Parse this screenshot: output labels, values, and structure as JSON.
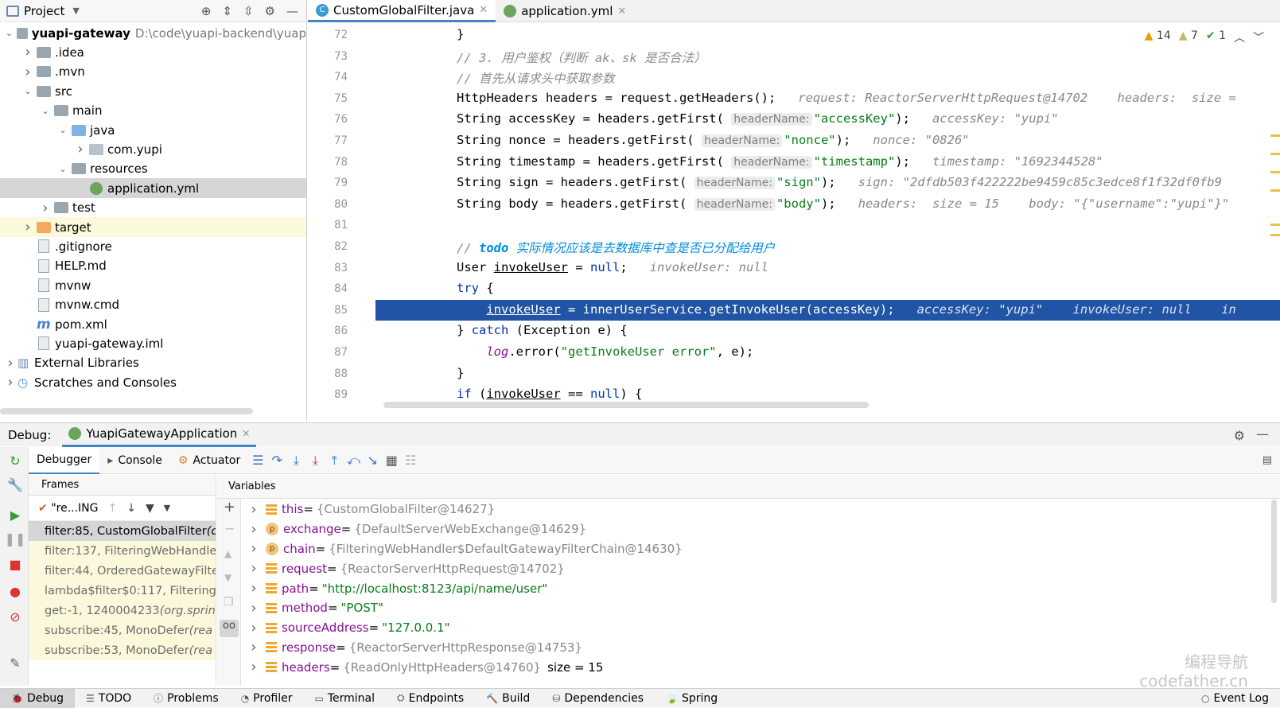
{
  "project": {
    "title": "Project",
    "tree": [
      {
        "label": "yuapi-gateway",
        "extra": "D:\\code\\yuapi-backend\\yuap",
        "indent": 0,
        "arrow": "down",
        "icon": "module-folder"
      },
      {
        "label": ".idea",
        "indent": 1,
        "arrow": "right",
        "icon": "folder"
      },
      {
        "label": ".mvn",
        "indent": 1,
        "arrow": "right",
        "icon": "folder"
      },
      {
        "label": "src",
        "indent": 1,
        "arrow": "down",
        "icon": "folder"
      },
      {
        "label": "main",
        "indent": 2,
        "arrow": "down",
        "icon": "folder"
      },
      {
        "label": "java",
        "indent": 3,
        "arrow": "down",
        "icon": "source-folder"
      },
      {
        "label": "com.yupi",
        "indent": 4,
        "arrow": "right",
        "icon": "package"
      },
      {
        "label": "resources",
        "indent": 3,
        "arrow": "down",
        "icon": "resources-folder"
      },
      {
        "label": "application.yml",
        "indent": 4,
        "arrow": "",
        "icon": "yml"
      },
      {
        "label": "test",
        "indent": 2,
        "arrow": "right",
        "icon": "folder"
      },
      {
        "label": "target",
        "indent": 1,
        "arrow": "right",
        "icon": "excluded-folder"
      },
      {
        "label": ".gitignore",
        "indent": 1,
        "arrow": "",
        "icon": "file"
      },
      {
        "label": "HELP.md",
        "indent": 1,
        "arrow": "",
        "icon": "markdown"
      },
      {
        "label": "mvnw",
        "indent": 1,
        "arrow": "",
        "icon": "file"
      },
      {
        "label": "mvnw.cmd",
        "indent": 1,
        "arrow": "",
        "icon": "file"
      },
      {
        "label": "pom.xml",
        "indent": 1,
        "arrow": "",
        "icon": "maven"
      },
      {
        "label": "yuapi-gateway.iml",
        "indent": 1,
        "arrow": "",
        "icon": "file"
      },
      {
        "label": "External Libraries",
        "indent": 0,
        "arrow": "right",
        "icon": "libraries"
      },
      {
        "label": "Scratches and Consoles",
        "indent": 0,
        "arrow": "right",
        "icon": "scratches"
      }
    ]
  },
  "editor_tabs": [
    {
      "label": "CustomGlobalFilter.java",
      "active": true
    },
    {
      "label": "application.yml",
      "active": false
    }
  ],
  "inspections": {
    "warnings": "14",
    "weak_warnings": "7",
    "ok": "1"
  },
  "code_lines": [
    {
      "num": "72",
      "html": "}"
    },
    {
      "num": "73",
      "html": "<span class='cm'>// 3. 用户鉴权（判断 ak、sk 是否合法）</span>"
    },
    {
      "num": "74",
      "html": "<span class='cm'>// 首先从请求头中获取参数</span>"
    },
    {
      "num": "75",
      "html": "HttpHeaders headers = request.getHeaders();   <span class='hint'>request: ReactorServerHttpRequest@14702    headers:  size = </span>"
    },
    {
      "num": "76",
      "html": "String accessKey = headers.getFirst( <span class='inlay'>headerName:</span><span class='str'>\"accessKey\"</span>);   <span class='hint'>accessKey: \"yupi\"</span>"
    },
    {
      "num": "77",
      "html": "String nonce = headers.getFirst( <span class='inlay'>headerName:</span><span class='str'>\"nonce\"</span>);   <span class='hint'>nonce: \"0826\"</span>"
    },
    {
      "num": "78",
      "html": "String timestamp = headers.getFirst( <span class='inlay'>headerName:</span><span class='str'>\"timestamp\"</span>);   <span class='hint'>timestamp: \"1692344528\"</span>"
    },
    {
      "num": "79",
      "html": "String sign = headers.getFirst( <span class='inlay'>headerName:</span><span class='str'>\"sign\"</span>);   <span class='hint'>sign: \"2dfdb503f422222be9459c85c3edce8f1f32df0fb9</span>"
    },
    {
      "num": "80",
      "html": "String body = headers.getFirst( <span class='inlay'>headerName:</span><span class='str'>\"body\"</span>);   <span class='hint'>headers:  size = 15    body: \"{\"username\":\"yupi\"}\"</span>"
    },
    {
      "num": "81",
      "html": ""
    },
    {
      "num": "82",
      "html": "<span class='cm'>// </span><span class='todo'><b>todo</b> 实际情况应该是去数据库中查是否已分配给用户</span>"
    },
    {
      "num": "83",
      "html": "User <u>invokeUser</u> = <span class='kw'>null</span>;   <span class='hint'>invokeUser: null</span>"
    },
    {
      "num": "84",
      "html": "<span class='kw'>try</span> {"
    },
    {
      "num": "85",
      "html": "    <u>invokeUser</u> = innerUserService.getInvokeUser(accessKey);   <span class='hint'>accessKey: \"yupi\"    invokeUser: null    in</span>",
      "exec": true
    },
    {
      "num": "86",
      "html": "} <span class='kw'>catch</span> (Exception e) {"
    },
    {
      "num": "87",
      "html": "    <span style='color:#871094;font-style:italic'>log</span>.error(<span class='str'>\"getInvokeUser error\"</span>, e);"
    },
    {
      "num": "88",
      "html": "}"
    },
    {
      "num": "89",
      "html": "<span class='kw'>if</span> (<u>invokeUser</u> == <span class='kw'>null</span>) {"
    }
  ],
  "debug": {
    "label": "Debug:",
    "config": "YuapiGatewayApplication",
    "tabs": [
      "Debugger",
      "Console",
      "Actuator"
    ],
    "frames_title": "Frames",
    "thread": "\"re...ING",
    "frames": [
      {
        "text": "filter:85, CustomGlobalFilter",
        "italic": " (c",
        "current": true
      },
      {
        "text": "filter:137, FilteringWebHandle",
        "italic": ""
      },
      {
        "text": "filter:44, OrderedGatewayFilte",
        "italic": ""
      },
      {
        "text": "lambda$filter$0:117, Filtering",
        "italic": ""
      },
      {
        "text": "get:-1, 1240004233 ",
        "italic": "(org.sprin"
      },
      {
        "text": "subscribe:45, MonoDefer ",
        "italic": "(rea"
      },
      {
        "text": "subscribe:53, MonoDefer ",
        "italic": "(rea"
      }
    ],
    "variables_title": "Variables",
    "variables": [
      {
        "icon": "field",
        "name": "this",
        "value": "{CustomGlobalFilter@14627}",
        "kind": "obj"
      },
      {
        "icon": "param",
        "name": "exchange",
        "value": "{DefaultServerWebExchange@14629}",
        "kind": "obj"
      },
      {
        "icon": "param",
        "name": "chain",
        "value": "{FilteringWebHandler$DefaultGatewayFilterChain@14630}",
        "kind": "obj"
      },
      {
        "icon": "field",
        "name": "request",
        "value": "{ReactorServerHttpRequest@14702}",
        "kind": "obj"
      },
      {
        "icon": "field",
        "name": "path",
        "value": "\"http://localhost:8123/api/name/user\"",
        "kind": "str"
      },
      {
        "icon": "field",
        "name": "method",
        "value": "\"POST\"",
        "kind": "str"
      },
      {
        "icon": "field",
        "name": "sourceAddress",
        "value": "\"127.0.0.1\"",
        "kind": "str"
      },
      {
        "icon": "field",
        "name": "response",
        "value": "{ReactorServerHttpResponse@14753}",
        "kind": "obj"
      },
      {
        "icon": "field",
        "name": "headers",
        "value": "{ReadOnlyHttpHeaders@14760}",
        "extra": "size = 15",
        "kind": "obj"
      }
    ]
  },
  "bottom_tools": [
    "Debug",
    "TODO",
    "Problems",
    "Profiler",
    "Terminal",
    "Endpoints",
    "Build",
    "Dependencies",
    "Spring",
    "Event Log"
  ],
  "watermark": {
    "line1": "编程导航",
    "line2": "codefather.cn"
  }
}
